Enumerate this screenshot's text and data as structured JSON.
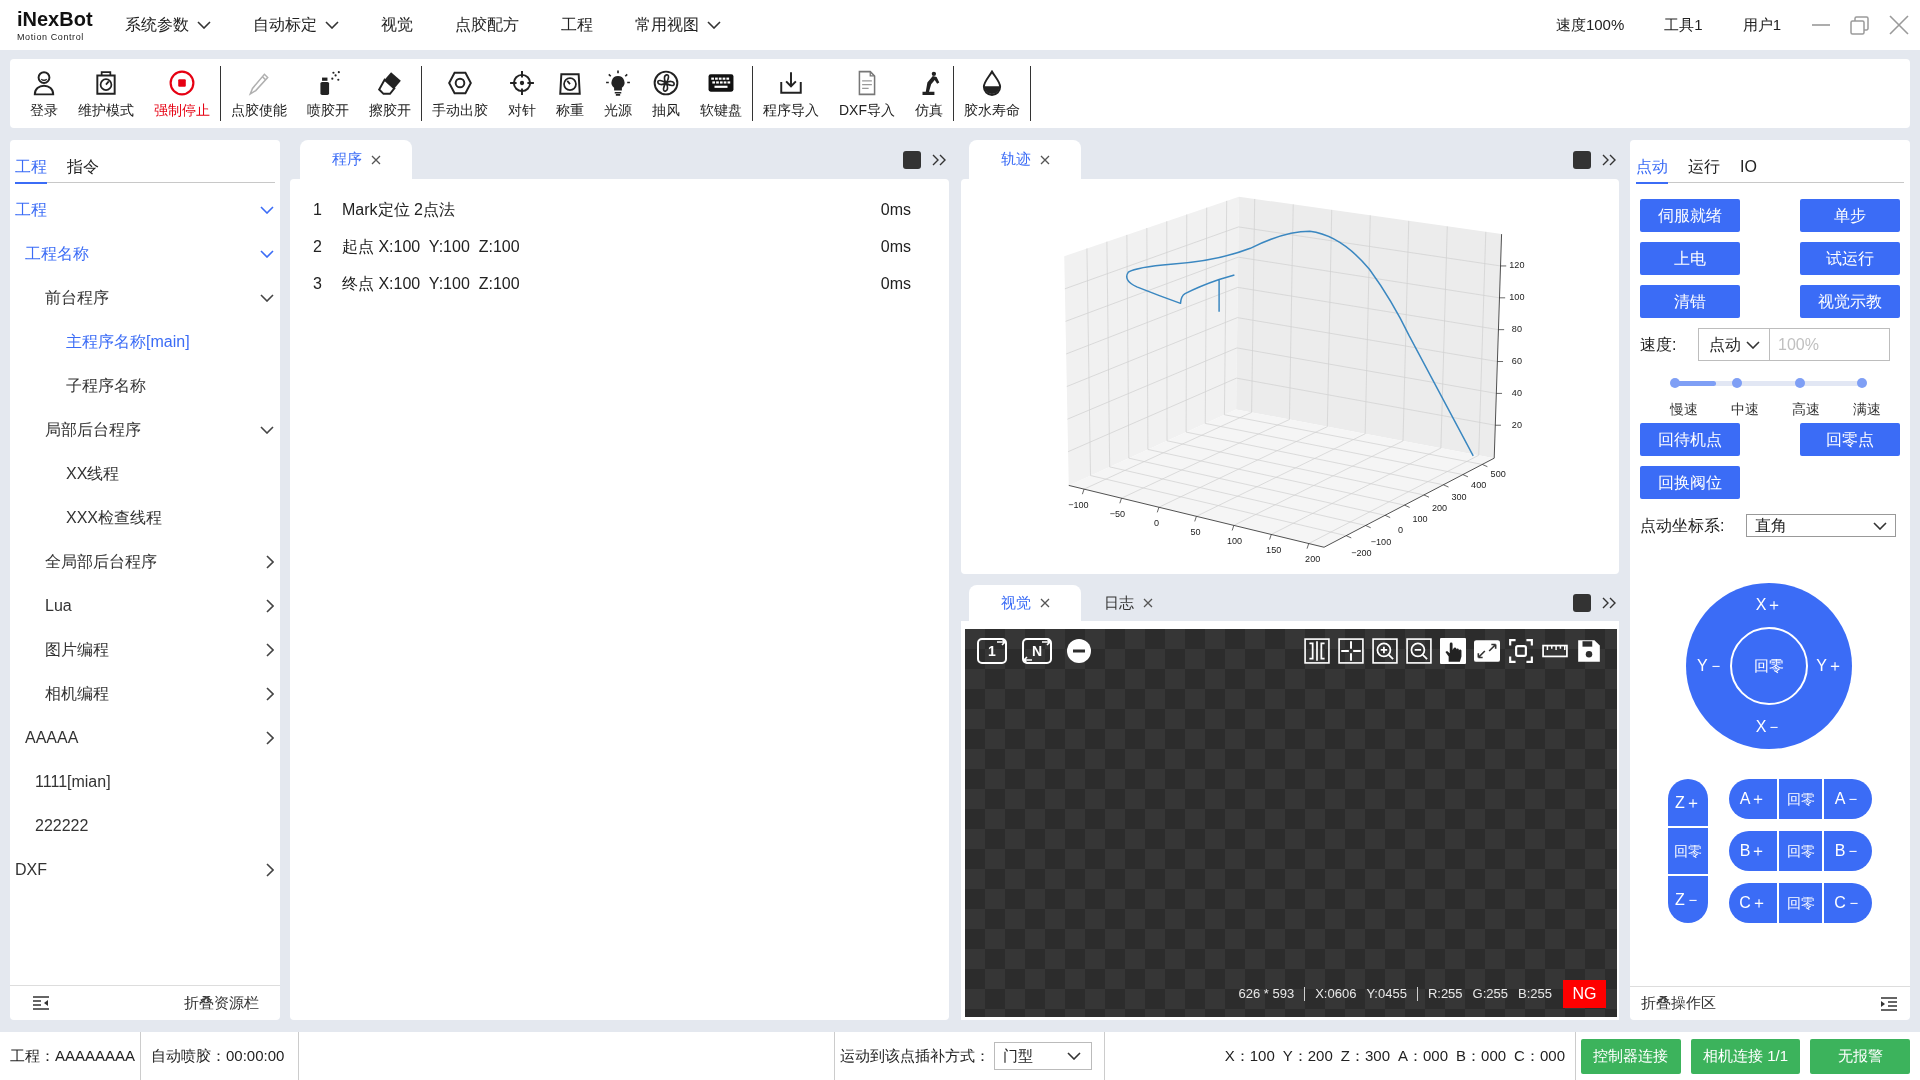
{
  "app": {
    "logo": {
      "name": "iNexBot",
      "tagline": "Motion Control"
    },
    "menu": [
      {
        "label": "系统参数",
        "dropdown": true
      },
      {
        "label": "自动标定",
        "dropdown": true
      },
      {
        "label": "视觉",
        "dropdown": false
      },
      {
        "label": "点胶配方",
        "dropdown": false
      },
      {
        "label": "工程",
        "dropdown": false
      },
      {
        "label": "常用视图",
        "dropdown": true
      }
    ],
    "status": [
      "速度100%",
      "工具1",
      "用户1"
    ]
  },
  "toolbar": {
    "groups": [
      [
        {
          "label": "登录",
          "kind": "normal"
        },
        {
          "label": "维护模式",
          "kind": "normal"
        },
        {
          "label": "强制停止",
          "kind": "danger"
        }
      ],
      [
        {
          "label": "点胶使能",
          "kind": "normal"
        },
        {
          "label": "喷胶开",
          "kind": "normal"
        },
        {
          "label": "擦胶开",
          "kind": "normal"
        }
      ],
      [
        {
          "label": "手动出胶",
          "kind": "normal"
        },
        {
          "label": "对针",
          "kind": "normal"
        },
        {
          "label": "称重",
          "kind": "normal"
        },
        {
          "label": "光源",
          "kind": "normal"
        },
        {
          "label": "抽风",
          "kind": "normal"
        },
        {
          "label": "软键盘",
          "kind": "normal"
        }
      ],
      [
        {
          "label": "程序导入",
          "kind": "normal"
        },
        {
          "label": "DXF导入",
          "kind": "normal"
        },
        {
          "label": "仿真",
          "kind": "normal"
        }
      ],
      [
        {
          "label": "胶水寿命",
          "kind": "normal"
        }
      ]
    ]
  },
  "explorer": {
    "tabs": [
      {
        "label": "工程",
        "selected": true
      },
      {
        "label": "指令",
        "selected": false
      }
    ],
    "tree": [
      {
        "label": "工程",
        "selected": true,
        "expanded": true,
        "children": [
          {
            "label": "工程名称",
            "selected": true,
            "expanded": true,
            "children": [
              {
                "label": "前台程序",
                "selected": false,
                "expanded": true,
                "children": [
                  {
                    "label": "主程序名称[main]",
                    "selected": true
                  },
                  {
                    "label": "子程序名称",
                    "selected": false
                  }
                ]
              },
              {
                "label": "局部后台程序",
                "selected": false,
                "expanded": true,
                "children": [
                  {
                    "label": "XX线程",
                    "selected": false
                  },
                  {
                    "label": "XXX检查线程",
                    "selected": false
                  }
                ]
              },
              {
                "label": "全局部后台程序",
                "selected": false,
                "expanded": false
              },
              {
                "label": "Lua",
                "selected": false,
                "expanded": false
              },
              {
                "label": "图片编程",
                "selected": false,
                "expanded": false
              },
              {
                "label": "相机编程",
                "selected": false,
                "expanded": false
              }
            ]
          },
          {
            "label": "AAAAA",
            "selected": false,
            "expanded": false
          },
          {
            "label": "1111[mian]",
            "selected": false
          },
          {
            "label": "222222",
            "selected": false
          }
        ]
      },
      {
        "label": "DXF",
        "selected": false,
        "expanded": false
      }
    ],
    "collapse": "折叠资源栏"
  },
  "program_panel": {
    "tabs": [
      {
        "label": "程序",
        "selected": true
      }
    ],
    "lines": [
      {
        "number": "1",
        "text": "Mark定位 2点法",
        "time": "0ms"
      },
      {
        "number": "2",
        "text": "起点 X:100  Y:100  Z:100",
        "time": "0ms"
      },
      {
        "number": "3",
        "text": "终点 X:100  Y:100  Z:100",
        "time": "0ms"
      }
    ]
  },
  "trajectory_panel": {
    "tabs": [
      {
        "label": "轨迹",
        "selected": true
      }
    ],
    "plot": {
      "x_ticks": [
        "−100",
        "−50",
        "0",
        "50",
        "100",
        "150",
        "200"
      ],
      "y_ticks": [
        "−200",
        "−100",
        "0",
        "100",
        "200",
        "300",
        "400",
        "500"
      ],
      "z_ticks": [
        "120",
        "100",
        "80",
        "60",
        "40",
        "20"
      ]
    }
  },
  "vision_panel": {
    "tabs": [
      {
        "label": "视觉",
        "selected": true
      },
      {
        "label": "日志",
        "selected": false
      }
    ],
    "capture_buttons": [
      "1",
      "N"
    ],
    "readout": [
      [
        "626 * 593"
      ],
      [
        "X:0606",
        "Y:0455"
      ],
      [
        "R:255",
        "G:255",
        "B:255"
      ]
    ],
    "result": {
      "label": "NG",
      "ok": false
    }
  },
  "control_panel": {
    "tabs": [
      {
        "label": "点动",
        "selected": true
      },
      {
        "label": "运行",
        "selected": false
      },
      {
        "label": "IO",
        "selected": false
      }
    ],
    "buttons": [
      "伺服就绪",
      "单步",
      "上电",
      "试运行",
      "清错",
      "视觉示教"
    ],
    "speed": {
      "label": "速度:",
      "mode": "点动",
      "placeholder": "100%",
      "level": 0.22,
      "stops": [
        "慢速",
        "中速",
        "高速",
        "满速"
      ]
    },
    "return_buttons": [
      "回待机点",
      "回零点",
      "回换阀位"
    ],
    "coordinate_system": {
      "label": "点动坐标系:",
      "value": "直角"
    },
    "jog_pad": {
      "up": "X＋",
      "left": "Y－",
      "center": "回零",
      "right": "Y＋",
      "down": "X－"
    },
    "z_axis": {
      "plus": "Z＋",
      "home": "回零",
      "minus": "Z－"
    },
    "axes": [
      {
        "plus": "A＋",
        "home": "回零",
        "minus": "A－"
      },
      {
        "plus": "B＋",
        "home": "回零",
        "minus": "B－"
      },
      {
        "plus": "C＋",
        "home": "回零",
        "minus": "C－"
      }
    ],
    "collapse": "折叠操作区"
  },
  "status_bar": {
    "project": "工程：AAAAAAAA",
    "auto_dispense": "自动喷胶：00:00:00",
    "interpolation": {
      "label": "运动到该点插补方式：",
      "value": "门型"
    },
    "coordinates": [
      "X：100",
      "Y：200",
      "Z：300",
      "A：000",
      "B：000",
      "C：000"
    ],
    "indicators": [
      "控制器连接",
      "相机连接 1/1",
      "无报警"
    ]
  }
}
